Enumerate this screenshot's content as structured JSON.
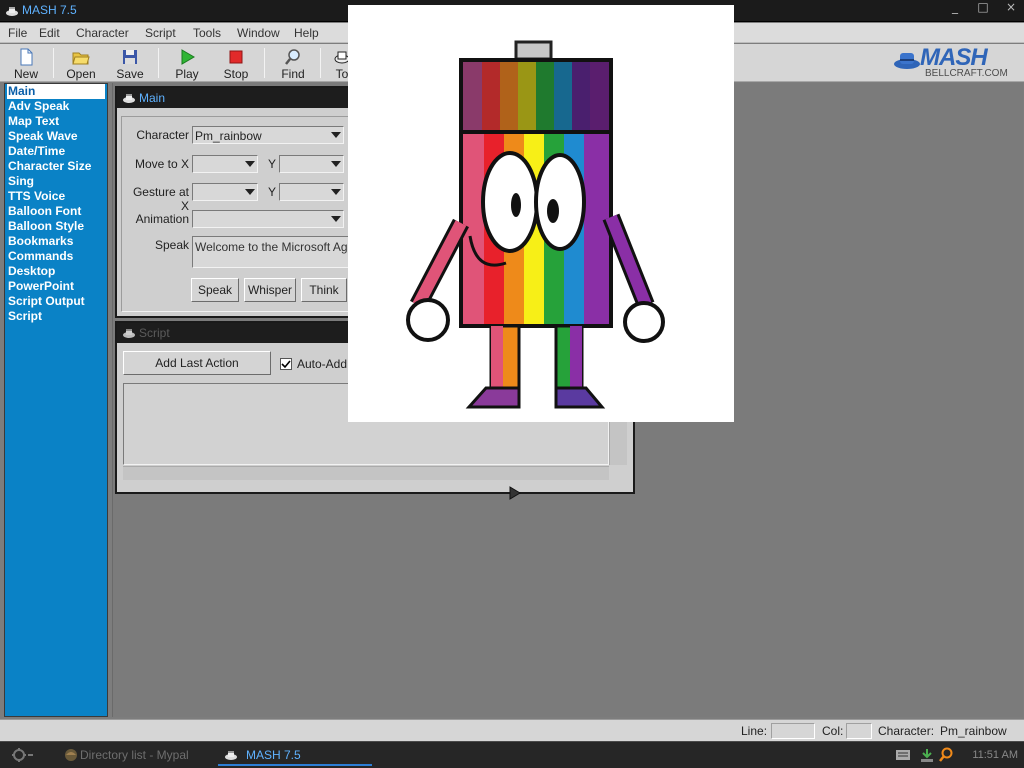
{
  "window": {
    "title": "MASH 7.5",
    "controls": [
      "_",
      "□",
      "×"
    ]
  },
  "menu": [
    "File",
    "Edit",
    "Character",
    "Script",
    "Tools",
    "Window",
    "Help"
  ],
  "toolbar": {
    "buttons": [
      {
        "label": "New",
        "icon": "new-page-icon"
      },
      {
        "label": "Open",
        "icon": "folder-open-icon"
      },
      {
        "label": "Save",
        "icon": "floppy-disk-icon"
      },
      {
        "label": "Play",
        "icon": "play-icon"
      },
      {
        "label": "Stop",
        "icon": "stop-icon"
      },
      {
        "label": "Find",
        "icon": "magnifier-icon"
      },
      {
        "label": "To",
        "icon": "tools-icon"
      }
    ]
  },
  "logo": {
    "name": "MASH",
    "site": "BELLCRAFT.COM"
  },
  "sidebar": {
    "items": [
      "Main",
      "Adv Speak",
      "Map Text",
      "Speak Wave",
      "Date/Time",
      "Character Size",
      "Sing",
      "TTS Voice",
      "Balloon Font",
      "Balloon Style",
      "Bookmarks",
      "Commands",
      "Desktop",
      "PowerPoint",
      "Script Output",
      "Script"
    ],
    "active": "Main"
  },
  "main_panel": {
    "title": "Main",
    "character_label": "Character",
    "character_value": "Pm_rainbow",
    "move_to_label": "Move to X",
    "gesture_at_label": "Gesture at X",
    "y_label": "Y",
    "animation_label": "Animation",
    "speak_label": "Speak",
    "speak_text": "Welcome to the Microsoft Agent",
    "buttons": {
      "speak": "Speak",
      "whisper": "Whisper",
      "think": "Think"
    }
  },
  "script_panel": {
    "title": "Script",
    "add_last_action": "Add Last Action",
    "auto_add_label": "Auto-Add A",
    "auto_add_checked": true
  },
  "statusbar": {
    "line_label": "Line:",
    "col_label": "Col:",
    "character_label": "Character:",
    "character_value": "Pm_rainbow"
  },
  "taskbar": {
    "tasks": [
      {
        "label": "Directory list - Mypal",
        "active": false
      },
      {
        "label": "MASH 7.5",
        "active": true
      }
    ],
    "clock": "11:51 AM"
  },
  "colors": {
    "accent": "#0a82c6",
    "title_text": "#5fb2ff",
    "rainbow": [
      "#e05478",
      "#e8212b",
      "#ee8a1a",
      "#f7ef17",
      "#26a23a",
      "#1f8bd0",
      "#7b2a9a"
    ]
  }
}
